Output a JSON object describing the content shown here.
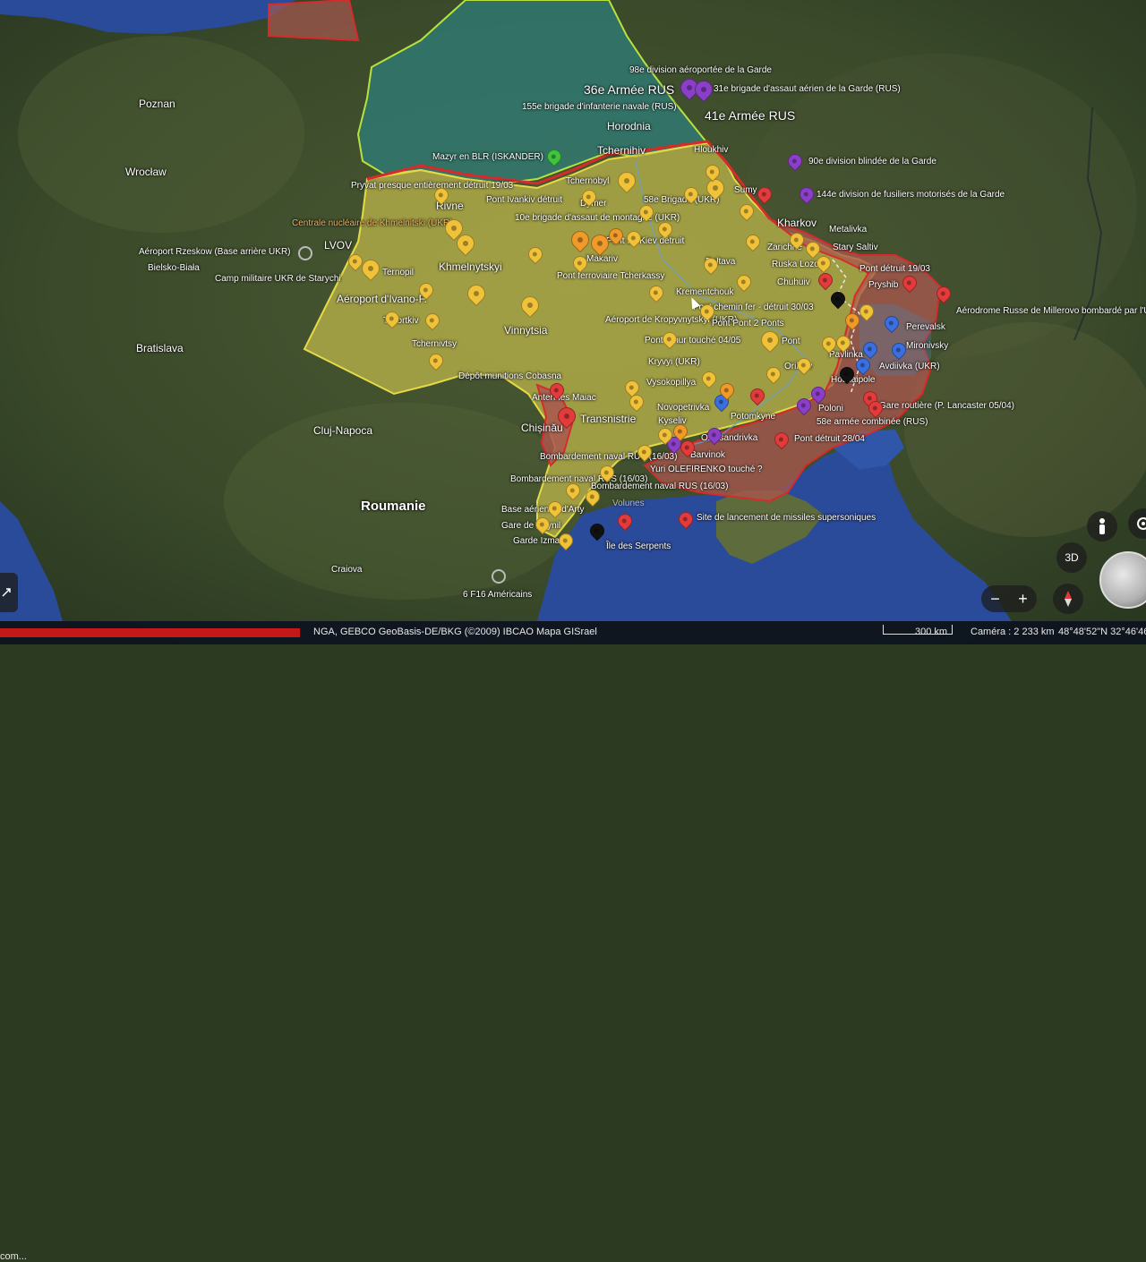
{
  "colors": {
    "ukraine_fill": "#b9b24a",
    "occupied_fill": "#a8574e",
    "belarus_fill": "#2f7d79",
    "border_yellow": "#e5da45",
    "border_red": "#d72b2b",
    "border_green": "#b7e23c",
    "sea": "#2a4a9a",
    "pin_yellow": "#f0c23a",
    "pin_red": "#e23b3b",
    "pin_purple": "#8b3fc7",
    "pin_blue": "#3b6fe0",
    "pin_green": "#3ec43e",
    "pin_orange": "#f09a2a",
    "pin_black": "#111111"
  },
  "labels": {
    "poznan": "Poznan",
    "wroclaw": "Wrocław",
    "bratislava": "Bratislava",
    "cluj": "Cluj-Napoca",
    "roumanie": "Roumanie",
    "craiova": "Craiova",
    "rivne": "Rivne",
    "lvov": "LVOV",
    "khmelnytskyi": "Khmelnytskyi",
    "ivano": "Aéroport d'Ivano-F.",
    "vinnytsia": "Vinnytsia",
    "transnistrie": "Transnistrie",
    "chisinau": "Chișinău",
    "kharkov": "Kharkov",
    "horodnia": "Horodnia",
    "tchernihiv": "Tchernihiv",
    "army36": "36e Armée RUS",
    "army41": "41e Armée RUS",
    "div98": "98e division aéroportée de la Garde",
    "brig31": "31e brigade d'assaut aérien de la Garde (RUS)",
    "brig155": "155e brigade d'infanterie navale (RUS)",
    "mazyr": "Mazyr en BLR (ISKANDER)",
    "div90": "90e division blindée de la Garde",
    "div144": "144e division de fusiliers motorisés de la Garde",
    "tchernobyl": "Tchernobyl",
    "pryvat": "Pryvat presque entièrement détruit 19/03",
    "pont_ivankiv": "Pont Ivankiv détruit",
    "dymer": "Dymer",
    "brig58": "58e Brigade (UKR)",
    "brig10": "10e brigade d'assaut de montagne (UKR)",
    "centrale": "Centrale nucléaire de Khmelnitski (UKR)",
    "rzeskow": "Aéroport Rzeskow (Base arrière UKR)",
    "bielsko": "Bielsko-Biała",
    "ternopil": "Ternopil",
    "camp": "Camp militaire UKR de Starychi",
    "pont_kiev": "Pont de Kiev détruit",
    "makariv": "Makariv",
    "pont_tcherkassy": "Pont ferroviaire Tcherkassy",
    "poltava": "Poltava",
    "krementchouk": "Krementchouk",
    "sumy": "Sumy",
    "zarichne": "Zarichne",
    "metalivka": "Metalivka",
    "stary_saltiv": "Stary Saltiv",
    "ruska_lozova": "Ruska Lozova",
    "chuhuiv": "Chuhuiv",
    "pont_1903": "Pont détruit 19/03",
    "pryshib": "Pryshib",
    "aerodrome_millerovo": "Aérodrome Russe de Millerovo bombardé par l'UKR",
    "pont_chemin": "Pont chemin fer - détruit 30/03",
    "pont_pont": "Pont Pont 2 Ponts",
    "aero_krop": "Aéroport de Kropyvnytskyi (UKR)",
    "pont_amur": "Pont Amur touché 04/05",
    "kryvyi": "Kryvyi (UKR)",
    "pont": "Pont",
    "pavlinka": "Pavlinka",
    "orikhiv": "Orikhiv",
    "mironivsky": "Mironivsky",
    "perevalsk": "Perevalsk",
    "avdiivka": "Avdiivka (UKR)",
    "houliaipole": "Houliaipole",
    "poloni": "Poloni",
    "gare_routiere": "Gare routière (P. Lancaster 05/04)",
    "armee58": "58e armée combinée (RUS)",
    "pont_2804": "Pont détruit 28/04",
    "vysokopillya": "Vysokopillya",
    "novopetrivka": "Novopetrivka",
    "kyseliv": "Kyseliv",
    "potomkyne": "Potomkyne",
    "oleksandrivka": "Oleksandrivka",
    "barvinok": "Barvinok",
    "yuri": "Yuri OLEFIRENKO touché ?",
    "bomb1": "Bombardement naval RUS (16/03)",
    "bomb2": "Bombardement naval RUS (16/03)",
    "bomb3": "Bombardement naval RUS (16/03)",
    "antennes": "Antennes Maiac",
    "depot": "Dépôt munitions Cobasna",
    "tchernivtsy": "Tchernivtsy",
    "tchortkiv": "Tchortkiv",
    "base_arty": "Base aérienne d'Arty",
    "gare_dzynil": "Gare de Dzynil",
    "garde_izmail": "Garde Izmail",
    "ile_serpents": "Île des Serpents",
    "site_missiles": "Site de lancement de missiles supersoniques",
    "f16": "6 F16 Américains",
    "volunes": "Volunes",
    "hloukhiv": "Hloukhiv"
  },
  "controls": {
    "btn_3d": "3D",
    "zoom_out": "−",
    "zoom_in": "+"
  },
  "status": {
    "attribution": "NGA, GEBCO  GeoBasis-DE/BKG (©2009)  IBCAO  Mapa GISrael",
    "scale": "300 km",
    "camera": "Caméra : 2 233 km",
    "coords": "48°48'52\"N 32°46'46\"E",
    "left_truncated": "com..."
  }
}
